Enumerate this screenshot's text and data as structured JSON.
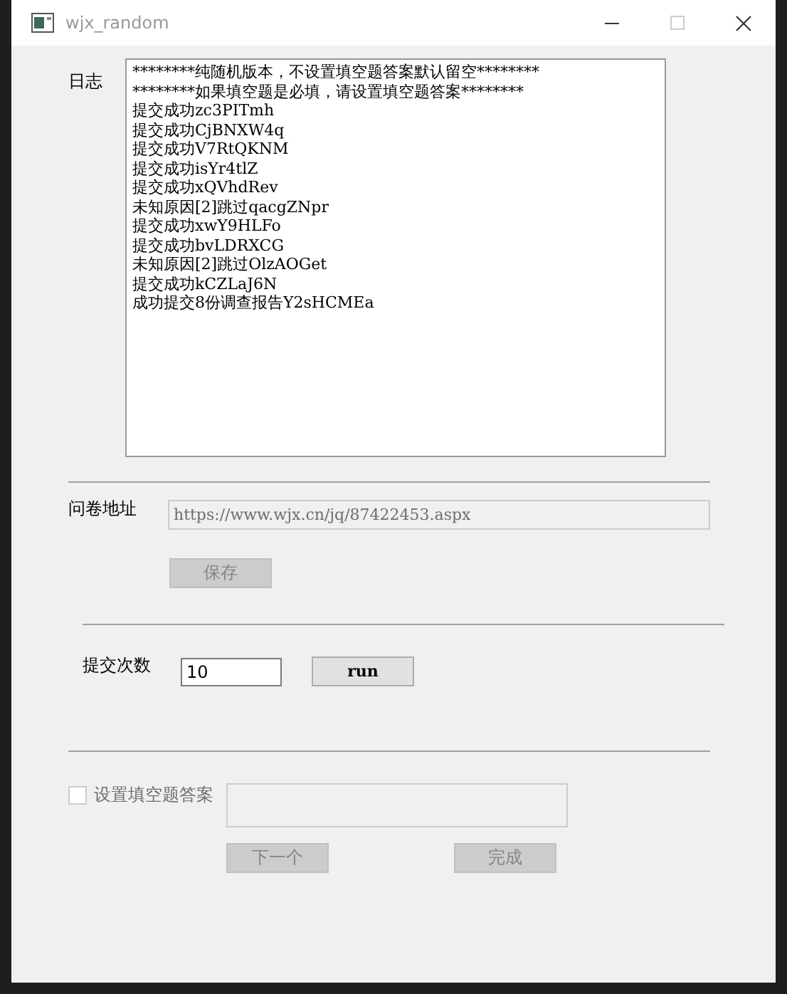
{
  "window": {
    "title": "wjx_random"
  },
  "log": {
    "label": "日志",
    "lines": [
      "********纯随机版本，不设置填空题答案默认留空********",
      "********如果填空题是必填，请设置填空题答案********",
      "提交成功zc3PITmh",
      "提交成功CjBNXW4q",
      "提交成功V7RtQKNM",
      "提交成功isYr4tlZ",
      "提交成功xQVhdRev",
      "未知原因[2]跳过qacgZNpr",
      "提交成功xwY9HLFo",
      "提交成功bvLDRXCG",
      "未知原因[2]跳过OlzAOGet",
      "提交成功kCZLaJ6N",
      "成功提交8份调查报告Y2sHCMEa"
    ]
  },
  "url": {
    "label": "问卷地址",
    "value": "https://www.wjx.cn/jq/87422453.aspx",
    "disabled": true
  },
  "save_button": {
    "label": "保存",
    "disabled": true
  },
  "submit_count": {
    "label": "提交次数",
    "value": "10"
  },
  "run_button": {
    "label": "run",
    "disabled": false
  },
  "answer": {
    "label": "设置填空题答案",
    "checked": false,
    "disabled": true
  },
  "answer_field": {
    "disabled": true
  },
  "buttons": [
    {
      "label": "下一个",
      "disabled": true
    },
    {
      "label": "完成",
      "disabled": true
    }
  ]
}
